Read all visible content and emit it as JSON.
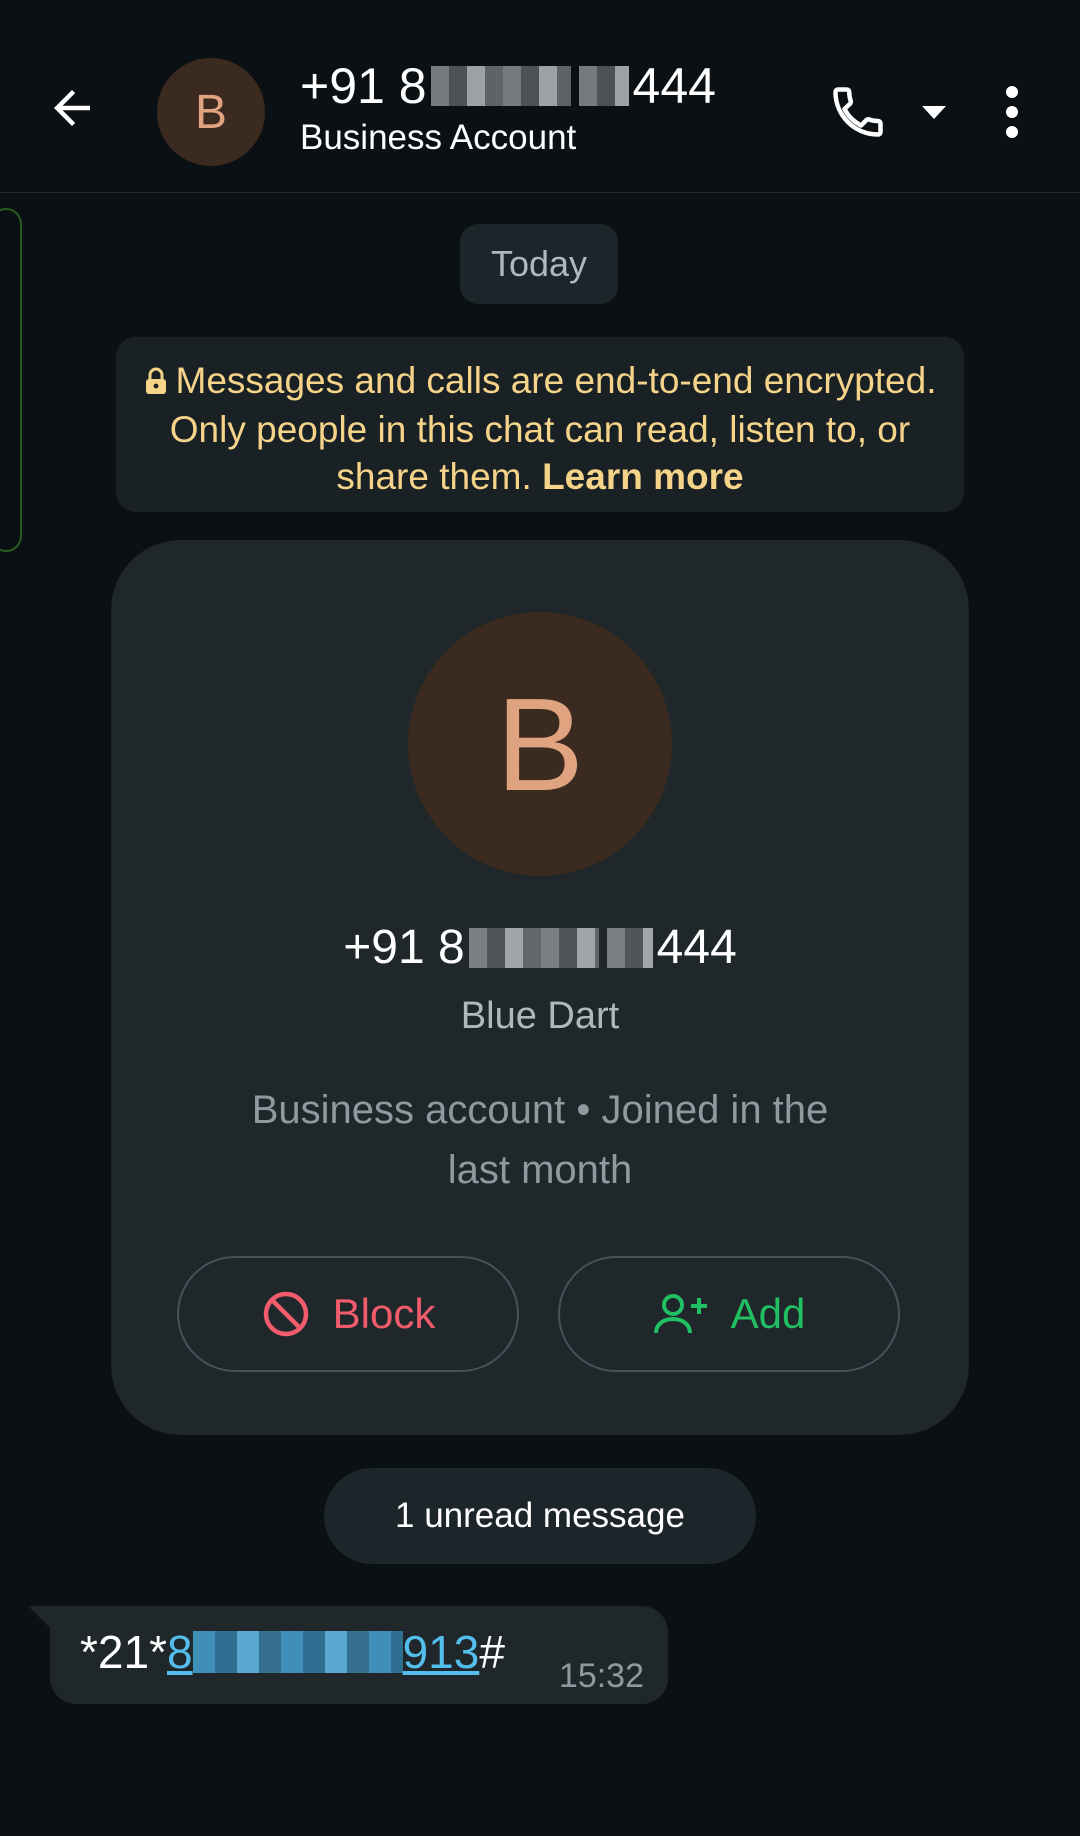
{
  "header": {
    "avatar_letter": "B",
    "number_prefix": "+91 8",
    "number_suffix": "444",
    "subtitle": "Business Account"
  },
  "date_chip": "Today",
  "encryption": {
    "text": "Messages and calls are end-to-end encrypted. Only people in this chat can read, listen to, or share them.",
    "link": "Learn more"
  },
  "card": {
    "avatar_letter": "B",
    "number_prefix": "+91 8",
    "number_suffix": "444",
    "name": "Blue Dart",
    "description": "Business account • Joined in the last month",
    "block_label": "Block",
    "add_label": "Add"
  },
  "unread": "1 unread message",
  "message": {
    "prefix": "*21*",
    "link_start": "8",
    "link_end": "913",
    "suffix": "#",
    "time": "15:32"
  },
  "colors": {
    "background": "#0b1014",
    "card": "#1f272b",
    "accent_green": "#21c063",
    "danger_red": "#f15c6d",
    "notice_yellow": "#f5d48a",
    "link_blue": "#53bdeb",
    "avatar_bg": "#3b2a20",
    "avatar_fg": "#e0a37f"
  }
}
